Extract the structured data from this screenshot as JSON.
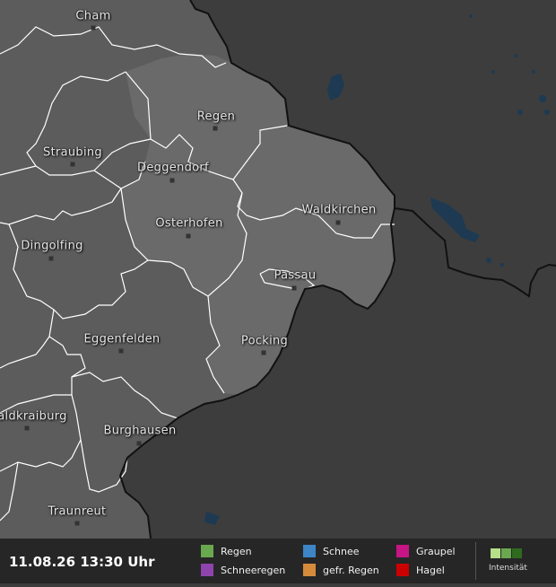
{
  "towns": [
    {
      "id": "cham",
      "name": "Cham"
    },
    {
      "id": "regen",
      "name": "Regen"
    },
    {
      "id": "straubing",
      "name": "Straubing"
    },
    {
      "id": "deggendorf",
      "name": "Deggendorf"
    },
    {
      "id": "waldkirchen",
      "name": "Waldkirchen"
    },
    {
      "id": "osterhofen",
      "name": "Osterhofen"
    },
    {
      "id": "dingolfing",
      "name": "Dingolfing"
    },
    {
      "id": "passau",
      "name": "Passau"
    },
    {
      "id": "eggenfelden",
      "name": "Eggenfelden"
    },
    {
      "id": "pocking",
      "name": "Pocking"
    },
    {
      "id": "waldkraiburg",
      "name": "aldkraiburg"
    },
    {
      "id": "burghausen",
      "name": "Burghausen"
    },
    {
      "id": "traunreut",
      "name": "Traunreut"
    }
  ],
  "footer": {
    "timestamp": "11.08.26 13:30 Uhr",
    "legend": [
      {
        "label": "Regen",
        "color": "#6aa84f"
      },
      {
        "label": "Schneeregen",
        "color": "#8e44ad"
      },
      {
        "label": "Schnee",
        "color": "#3d85c6"
      },
      {
        "label": "gefr. Regen",
        "color": "#d68a3c"
      },
      {
        "label": "Graupel",
        "color": "#c71585"
      },
      {
        "label": "Hagel",
        "color": "#cc0000"
      }
    ],
    "intensity_label": "Intensität",
    "intensity_colors": [
      "#b6e08a",
      "#6aa84f",
      "#2f6b1e"
    ]
  }
}
